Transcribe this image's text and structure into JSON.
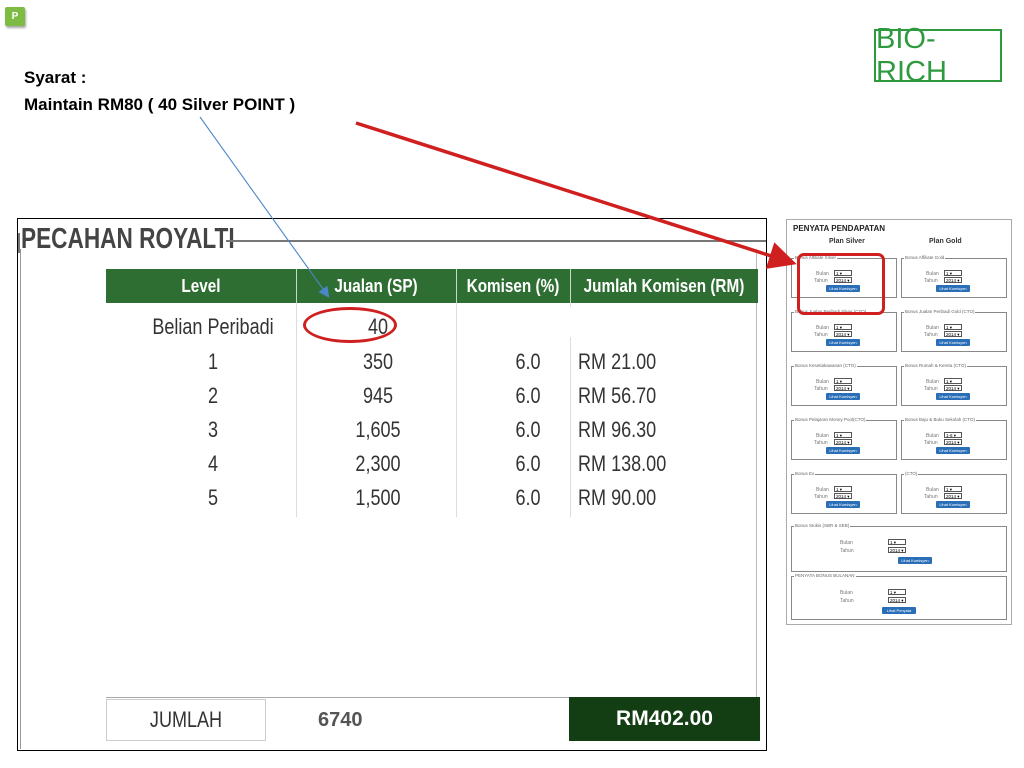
{
  "slide": {
    "badge": "P",
    "logo_text": "BIO-RICH",
    "syarat_line1": "Syarat :",
    "syarat_line2": "Maintain RM80 ( 40 Silver POINT )"
  },
  "royalti": {
    "title": "PECAHAN ROYALTI",
    "headers": [
      "Level",
      "Jualan (SP)",
      "Komisen (%)",
      "Jumlah Komisen (RM)"
    ],
    "rows": [
      {
        "level": "Belian Peribadi",
        "jualan": "40",
        "komisen": "",
        "jumlah": ""
      },
      {
        "level": "1",
        "jualan": "350",
        "komisen": "6.0",
        "jumlah": "RM 21.00"
      },
      {
        "level": "2",
        "jualan": "945",
        "komisen": "6.0",
        "jumlah": "RM 56.70"
      },
      {
        "level": "3",
        "jualan": "1,605",
        "komisen": "6.0",
        "jumlah": "RM 96.30"
      },
      {
        "level": "4",
        "jualan": "2,300",
        "komisen": "6.0",
        "jumlah": "RM 138.00"
      },
      {
        "level": "5",
        "jualan": "1,500",
        "komisen": "6.0",
        "jumlah": "RM 90.00"
      }
    ],
    "total_label": "JUMLAH",
    "total_sp": "6740",
    "total_rm": "RM402.00"
  },
  "pendapatan": {
    "title": "PENYATA PENDAPATAN",
    "plan_silver": "Plan Silver",
    "plan_gold": "Plan Gold",
    "bulan_label": "Bulan",
    "tahun_label": "Tahun",
    "bulan_value": "1",
    "tahun_value": "2014",
    "bulan_value_alt": "1-6",
    "lihat_komisyen": "Lihat Komisyen",
    "lihat_penyata": "Lihat Penyata",
    "sections": [
      {
        "left": "Bonus Affiliate Silver",
        "right": "Bonus Affiliate Gold"
      },
      {
        "left": "Bonus Jualan Peribadi Silver (CTO)",
        "right": "Bonus Jualan Peribadi Gold (CTO)"
      },
      {
        "left": "Bonus Kesetiakawanan (CTO)",
        "right": "Bonus Rumah & Kereta (CTO)"
      },
      {
        "left": "Bonus Pelajaran Money Pool(CTO)",
        "right": "Bonus Baju & Buku Sekolah (CTO)"
      },
      {
        "left": "Bonus Ex",
        "right": "(CTO)"
      }
    ],
    "stokis_label": "Bonus Stokis (SBR & SEB)",
    "bulanan_label": "PENYATA BONUS BULANAN"
  }
}
